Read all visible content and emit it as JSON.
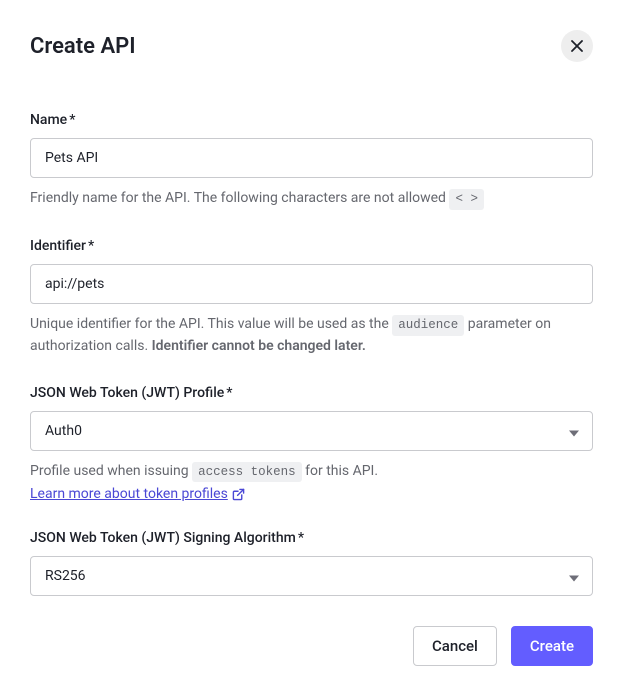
{
  "dialog": {
    "title": "Create API"
  },
  "form": {
    "name": {
      "label": "Name",
      "value": "Pets API",
      "help_prefix": "Friendly name for the API. The following characters are not allowed ",
      "help_code": "< >"
    },
    "identifier": {
      "label": "Identifier",
      "value": "api://pets",
      "help_prefix": "Unique identifier for the API. This value will be used as the ",
      "help_code": "audience",
      "help_suffix": " parameter on authorization calls. ",
      "help_bold": "Identifier cannot be changed later."
    },
    "jwt_profile": {
      "label": "JSON Web Token (JWT) Profile",
      "value": "Auth0",
      "help_prefix": "Profile used when issuing ",
      "help_code": "access tokens",
      "help_suffix": " for this API.",
      "link_text": "Learn more about token profiles"
    },
    "jwt_algorithm": {
      "label": "JSON Web Token (JWT) Signing Algorithm",
      "value": "RS256"
    }
  },
  "required_marker": "*",
  "actions": {
    "cancel": "Cancel",
    "create": "Create"
  }
}
